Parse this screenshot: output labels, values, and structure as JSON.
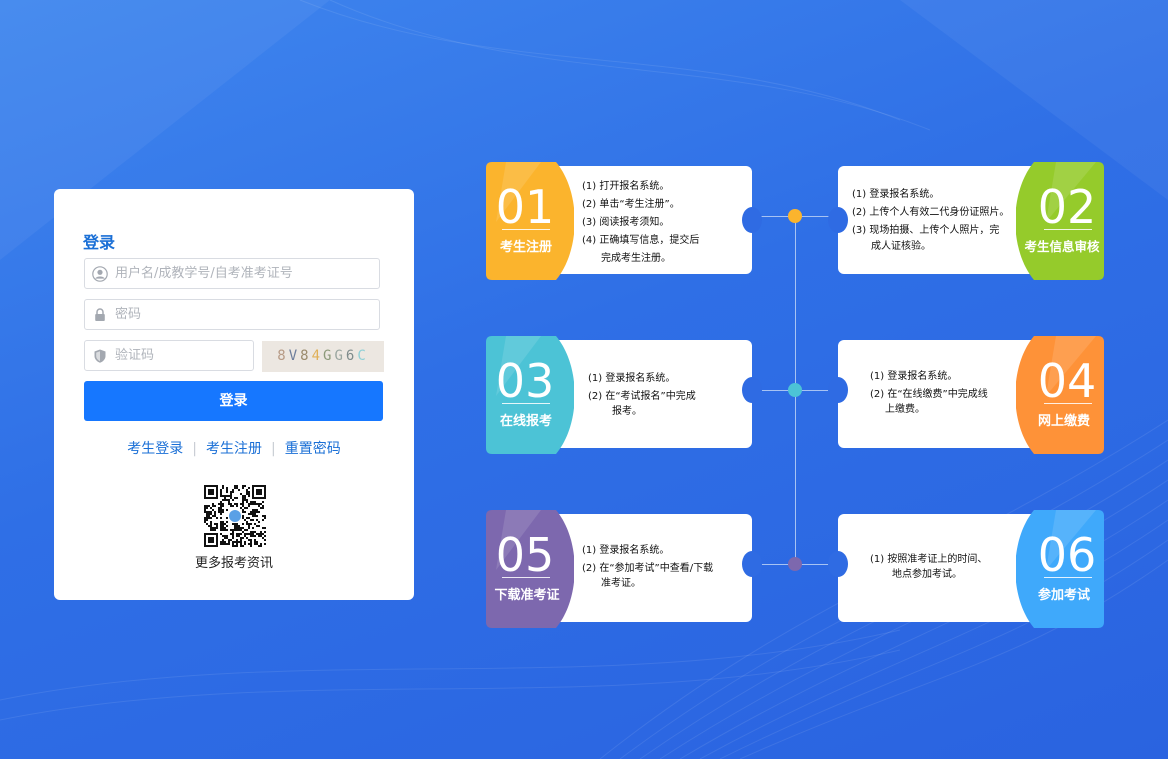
{
  "login": {
    "title": "登录",
    "username_placeholder": "用户名/成教学号/自考准考证号",
    "password_placeholder": "密码",
    "captcha_placeholder": "验证码",
    "captcha_text": "8V84GG6C",
    "submit_label": "登录",
    "links": [
      "考生登录",
      "考生注册",
      "重置密码"
    ],
    "qr_caption": "更多报考资讯"
  },
  "steps": [
    {
      "num": "01",
      "label": "考生注册",
      "color": "#fbb42d",
      "lines": [
        "(1) 打开报名系统。",
        "(2) 单击“考生注册”。",
        "(3) 阅读报考须知。",
        "(4) 正确填写信息，提交后",
        "完成考生注册。"
      ]
    },
    {
      "num": "02",
      "label": "考生信息审核",
      "color": "#95cb2b",
      "lines": [
        "(1) 登录报名系统。",
        "(2) 上传个人有效二代身份证照片。",
        "(3) 现场拍摄、上传个人照片，完",
        "成人证核验。"
      ]
    },
    {
      "num": "03",
      "label": "在线报考",
      "color": "#4cc3d6",
      "lines": [
        "(1)  登录报名系统。",
        "(2)  在“考试报名”中完成",
        "报考。"
      ]
    },
    {
      "num": "04",
      "label": "网上缴费",
      "color": "#fe9238",
      "lines": [
        "(1) 登录报名系统。",
        "(2) 在“在线缴费”中完成线",
        "上缴费。"
      ]
    },
    {
      "num": "05",
      "label": "下载准考证",
      "color": "#7d68ae",
      "lines": [
        "(1) 登录报名系统。",
        "(2) 在“参加考试”中查看/下载",
        "准考证。"
      ]
    },
    {
      "num": "06",
      "label": "参加考试",
      "color": "#3fa9fb",
      "lines": [
        "(1) 按照准考证上的时间、",
        "地点参加考试。"
      ]
    }
  ],
  "connector_dots": [
    "#fbb42d",
    "#4cc3d6",
    "#7d68ae"
  ]
}
